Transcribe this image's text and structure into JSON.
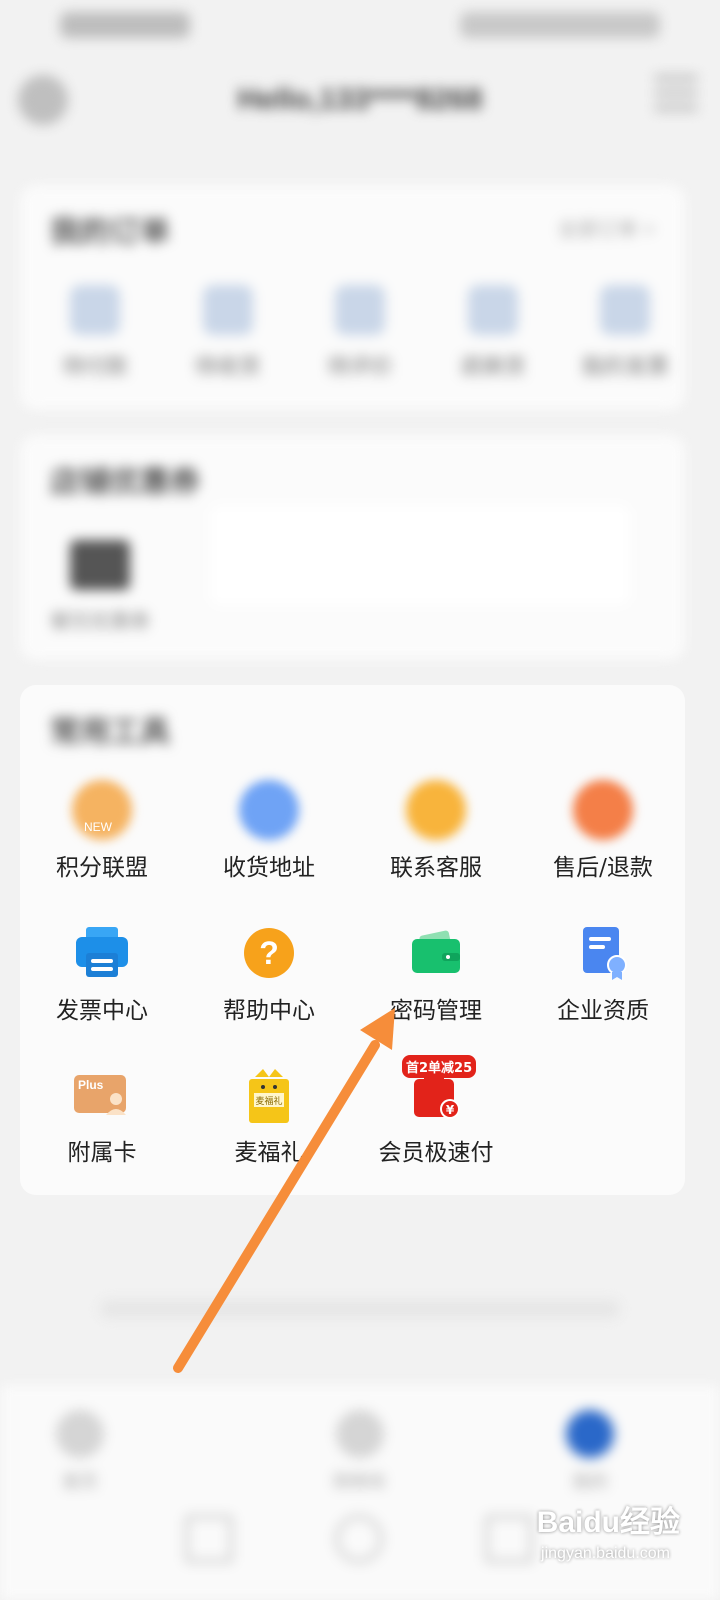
{
  "status_bar": {
    "left_text": "",
    "right_text": ""
  },
  "header": {
    "greeting": "Hello,133****8268"
  },
  "orders_card": {
    "title": "我的订单",
    "link": "全部订单 >",
    "items": [
      "待付款",
      "待收货",
      "待评价",
      "退换货",
      "我的发票"
    ]
  },
  "promo_card": {
    "title": "店铺优惠券",
    "thumb_label": "餐饮优惠券"
  },
  "tools_card": {
    "title": "常用工具",
    "items": [
      {
        "label": "积分联盟",
        "icon": "points-icon",
        "badge": "NEW",
        "color": "#f5b361"
      },
      {
        "label": "收货地址",
        "icon": "location-icon",
        "color": "#6fa3f5"
      },
      {
        "label": "联系客服",
        "icon": "customer-service-icon",
        "color": "#f8b43c"
      },
      {
        "label": "售后/退款",
        "icon": "refund-icon",
        "color": "#f47f48"
      },
      {
        "label": "发票中心",
        "icon": "printer-icon",
        "color": "#1d8fe8"
      },
      {
        "label": "帮助中心",
        "icon": "question-icon",
        "color": "#f7a21b"
      },
      {
        "label": "密码管理",
        "icon": "wallet-icon",
        "color": "#18c06e"
      },
      {
        "label": "企业资质",
        "icon": "certificate-icon",
        "color": "#4a86f0"
      },
      {
        "label": "附属卡",
        "icon": "plus-card-icon",
        "badge": "Plus",
        "color": "#e8a46a"
      },
      {
        "label": "麦福礼",
        "icon": "gift-icon",
        "badge": "麦福礼",
        "color": "#f5c518"
      },
      {
        "label": "会员极速付",
        "icon": "fast-pay-icon",
        "badge": "首2单减25",
        "color": "#e2231a"
      }
    ]
  },
  "footer": {
    "brand": "",
    "note": ""
  },
  "bottom_nav": {
    "items": [
      "首页",
      "购物车",
      "我的"
    ]
  },
  "watermark": {
    "main": "Baidu经验",
    "sub": "jingyan.baidu.com"
  }
}
